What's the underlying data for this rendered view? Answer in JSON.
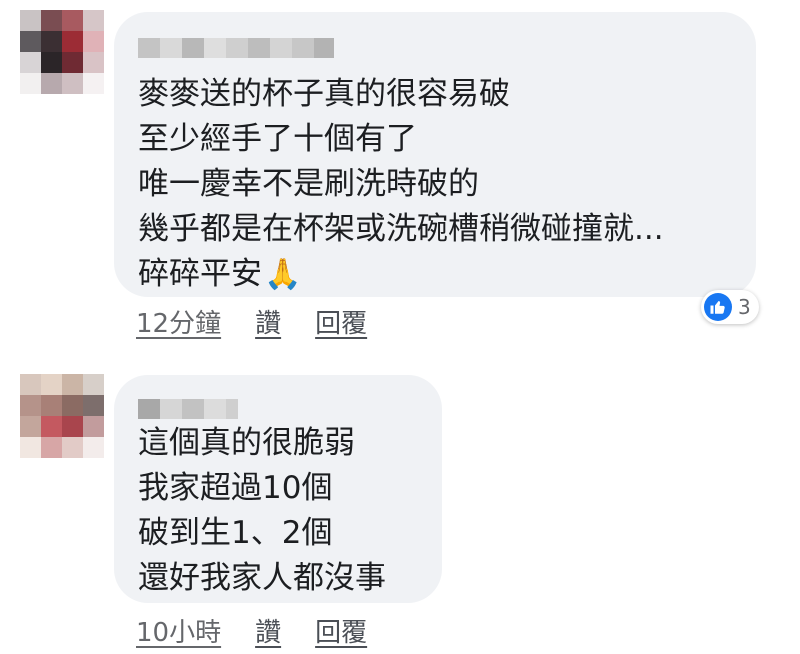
{
  "comments": [
    {
      "lines": [
        "麥麥送的杯子真的很容易破",
        "至少經手了十個有了",
        "唯一慶幸不是刷洗時破的",
        "幾乎都是在杯架或洗碗槽稍微碰撞就...",
        "碎碎平安"
      ],
      "emoji": "🙏",
      "emoji_name": "folded-hands-icon",
      "time": "12分鐘",
      "like_label": "讚",
      "reply_label": "回覆",
      "reaction_icon": "thumbs-up-icon",
      "reaction_count": "3"
    },
    {
      "lines": [
        "這個真的很脆弱",
        "我家超過10個",
        "破到生1、2個",
        "還好我家人都沒事"
      ],
      "time": "10小時",
      "like_label": "讚",
      "reply_label": "回覆"
    }
  ],
  "colors": {
    "bubble": "#f0f2f5",
    "accent": "#1877f2",
    "meta_text": "#65676b"
  }
}
